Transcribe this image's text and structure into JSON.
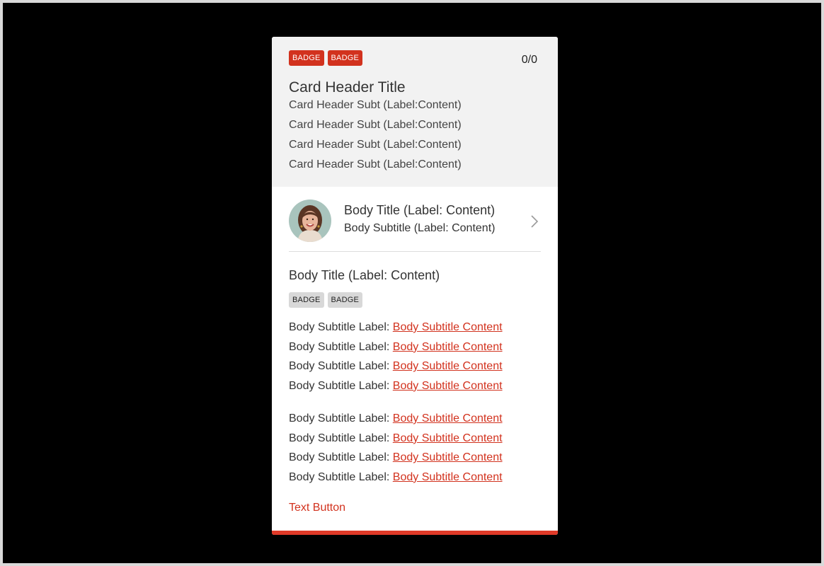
{
  "header": {
    "badges": [
      "BADGE",
      "BADGE"
    ],
    "counter": "0/0",
    "title": "Card Header Title",
    "subtitles": [
      "Card Header Subt (Label:Content)",
      "Card Header Subt (Label:Content)",
      "Card Header Subt (Label:Content)",
      "Card Header Subt (Label:Content)"
    ]
  },
  "person": {
    "title": "Body Title (Label: Content)",
    "subtitle": "Body Subtitle (Label: Content)",
    "chevron_icon": "chevron-right-icon"
  },
  "body": {
    "title": "Body Title (Label: Content)",
    "badges": [
      "BADGE",
      "BADGE"
    ],
    "group1": [
      {
        "label": "Body Subtitle Label:",
        "content": "Body Subtitle Content"
      },
      {
        "label": "Body Subtitle Label:",
        "content": "Body Subtitle Content"
      },
      {
        "label": "Body Subtitle Label:",
        "content": "Body Subtitle Content"
      },
      {
        "label": "Body Subtitle Label:",
        "content": "Body Subtitle Content"
      }
    ],
    "group2": [
      {
        "label": "Body Subtitle Label:",
        "content": "Body Subtitle Content"
      },
      {
        "label": "Body Subtitle Label:",
        "content": "Body Subtitle Content"
      },
      {
        "label": "Body Subtitle Label:",
        "content": "Body Subtitle Content"
      },
      {
        "label": "Body Subtitle Label:",
        "content": "Body Subtitle Content"
      }
    ]
  },
  "text_button": "Text Button",
  "colors": {
    "accent": "#d2321e",
    "header_bg": "#f2f2f2",
    "badge_gray": "#d8d8d8"
  }
}
